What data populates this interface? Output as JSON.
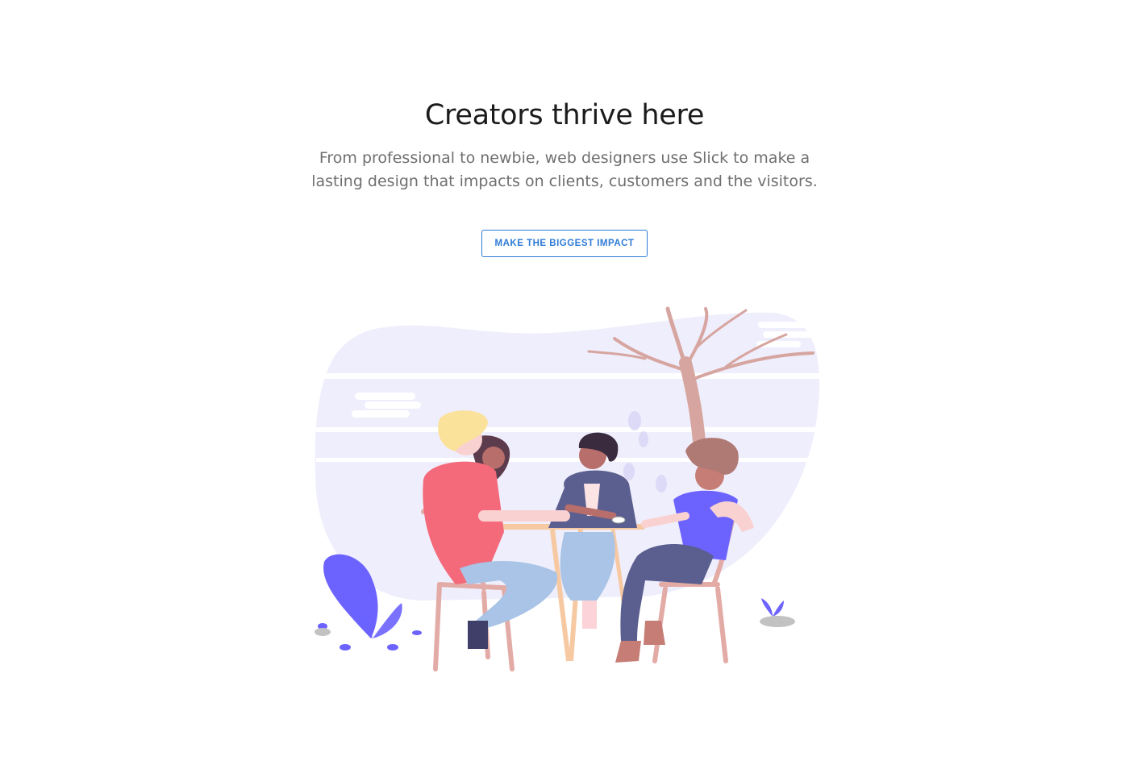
{
  "hero": {
    "title": "Creators thrive here",
    "subtitle_lines": [
      "From professional to newbie, web designers use Slick to make a",
      "lasting design that impacts on clients, customers and the visitors."
    ],
    "cta_label": "MAKE THE BIGGEST IMPACT"
  },
  "colors": {
    "title": "#1b1b1b",
    "subtitle": "#6f6f6f",
    "accent": "#2e7bd6",
    "backdrop": "#efeefc",
    "plant": "#6c63ff",
    "tree": "#d7a5a0"
  },
  "illustration": {
    "name": "people-meeting-under-tree-illustration"
  }
}
